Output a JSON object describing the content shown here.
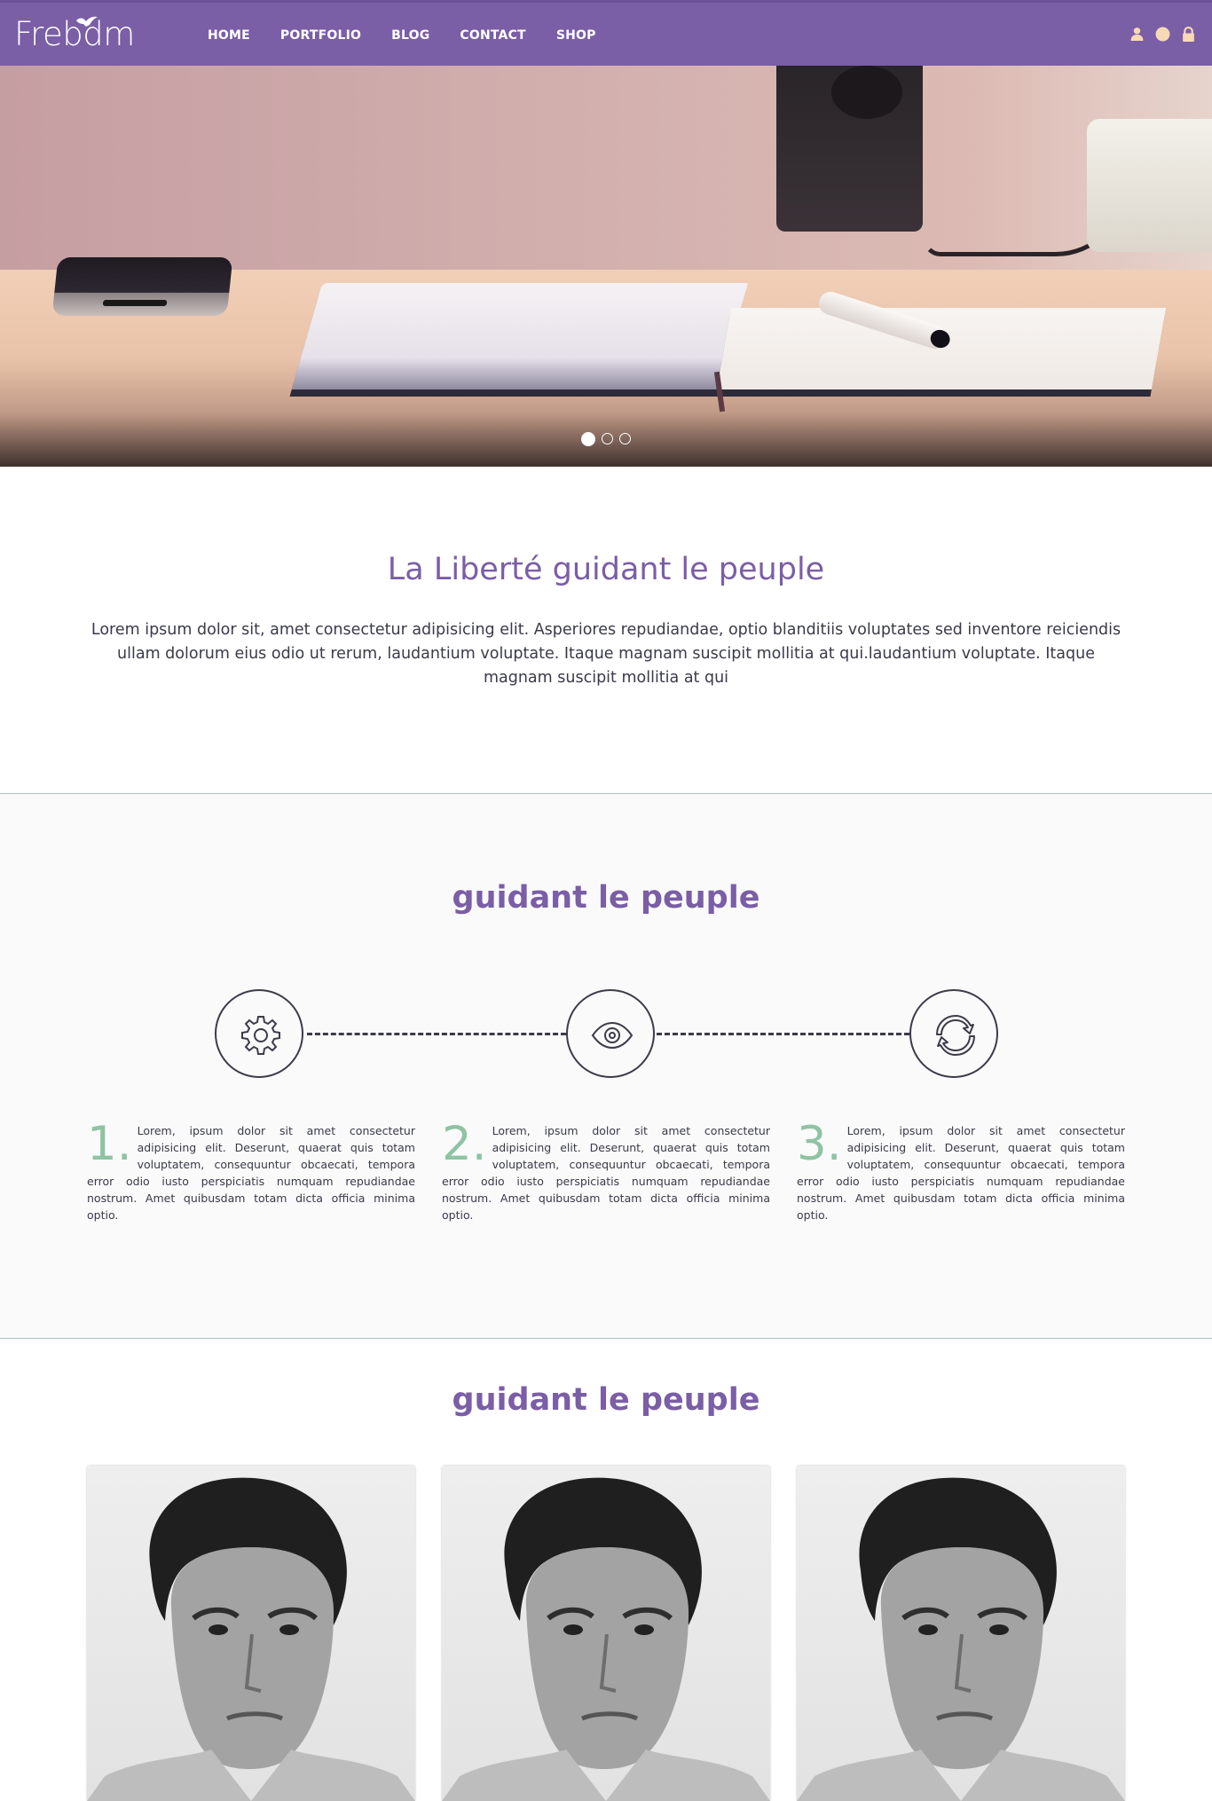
{
  "brand": {
    "name": "Frebdm"
  },
  "nav": {
    "items": [
      {
        "label": "HOME",
        "active": true
      },
      {
        "label": "PORTFOLIO",
        "active": false
      },
      {
        "label": "BLOG",
        "active": false
      },
      {
        "label": "CONTACT",
        "active": false
      },
      {
        "label": "SHOP",
        "active": false
      }
    ],
    "icons": [
      "user-icon",
      "circle-icon",
      "lock-icon"
    ]
  },
  "slider": {
    "slides": 3,
    "active_slide": 1
  },
  "intro": {
    "title": "La Liberté guidant le peuple",
    "text": "Lorem ipsum dolor sit, amet consectetur adipisicing elit. Asperiores repudiandae, optio blanditiis voluptates sed inventore reiciendis ullam dolorum eius odio ut rerum, laudantium voluptate. Itaque magnam suscipit mollitia at qui.laudantium voluptate. Itaque magnam suscipit mollitia at qui"
  },
  "process": {
    "title": "guidant le peuple",
    "icons": [
      "gear-icon",
      "eye-icon",
      "refresh-icon"
    ],
    "steps": [
      {
        "number": "1.",
        "text": "Lorem, ipsum dolor sit amet consectetur adipisicing elit. Deserunt, quaerat quis totam voluptatem, consequuntur obcaecati, tempora error odio iusto perspiciatis numquam repudiandae nostrum. Amet quibusdam totam dicta officia minima optio."
      },
      {
        "number": "2.",
        "text": "Lorem, ipsum dolor sit amet consectetur adipisicing elit. Deserunt, quaerat quis totam voluptatem, consequuntur obcaecati, tempora error odio iusto perspiciatis numquam repudiandae nostrum. Amet quibusdam totam dicta officia minima optio."
      },
      {
        "number": "3.",
        "text": "Lorem, ipsum dolor sit amet consectetur adipisicing elit. Deserunt, quaerat quis totam voluptatem, consequuntur obcaecati, tempora error odio iusto perspiciatis numquam repudiandae nostrum. Amet quibusdam totam dicta officia minima optio."
      }
    ]
  },
  "team": {
    "title": "guidant le peuple",
    "members": 3
  },
  "colors": {
    "brand_purple": "#7a5ea6",
    "accent_green": "#8fc3a3",
    "nav_icon": "#f6d9b5",
    "text_dark": "#3a3a4a"
  }
}
